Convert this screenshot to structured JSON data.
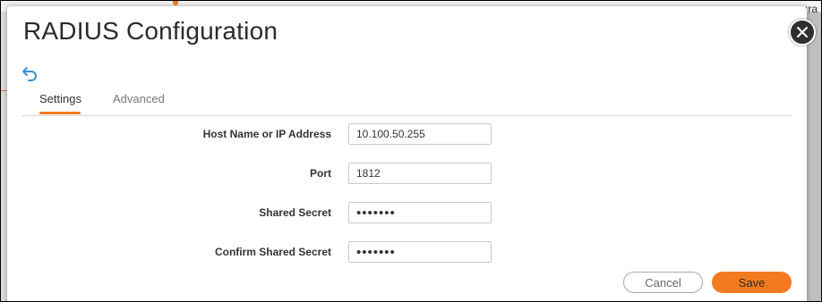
{
  "background": {
    "corner_text": "ıra",
    "accent_color": "#f47a20"
  },
  "dialog": {
    "title": "RADIUS Configuration",
    "close_icon": "close-circle-icon",
    "back_icon": "undo-arrow-icon"
  },
  "tabs": [
    {
      "label": "Settings",
      "active": true
    },
    {
      "label": "Advanced",
      "active": false
    }
  ],
  "form": {
    "host": {
      "label": "Host Name or IP Address",
      "value": "10.100.50.255"
    },
    "port": {
      "label": "Port",
      "value": "1812"
    },
    "secret": {
      "label": "Shared Secret",
      "value": "•••••••"
    },
    "confirm_secret": {
      "label": "Confirm Shared Secret",
      "value": "•••••••"
    }
  },
  "buttons": {
    "cancel": "Cancel",
    "save": "Save"
  },
  "colors": {
    "primary": "#f47a20",
    "back_icon": "#3d8fd1",
    "close_button": "#2f2f2f"
  }
}
